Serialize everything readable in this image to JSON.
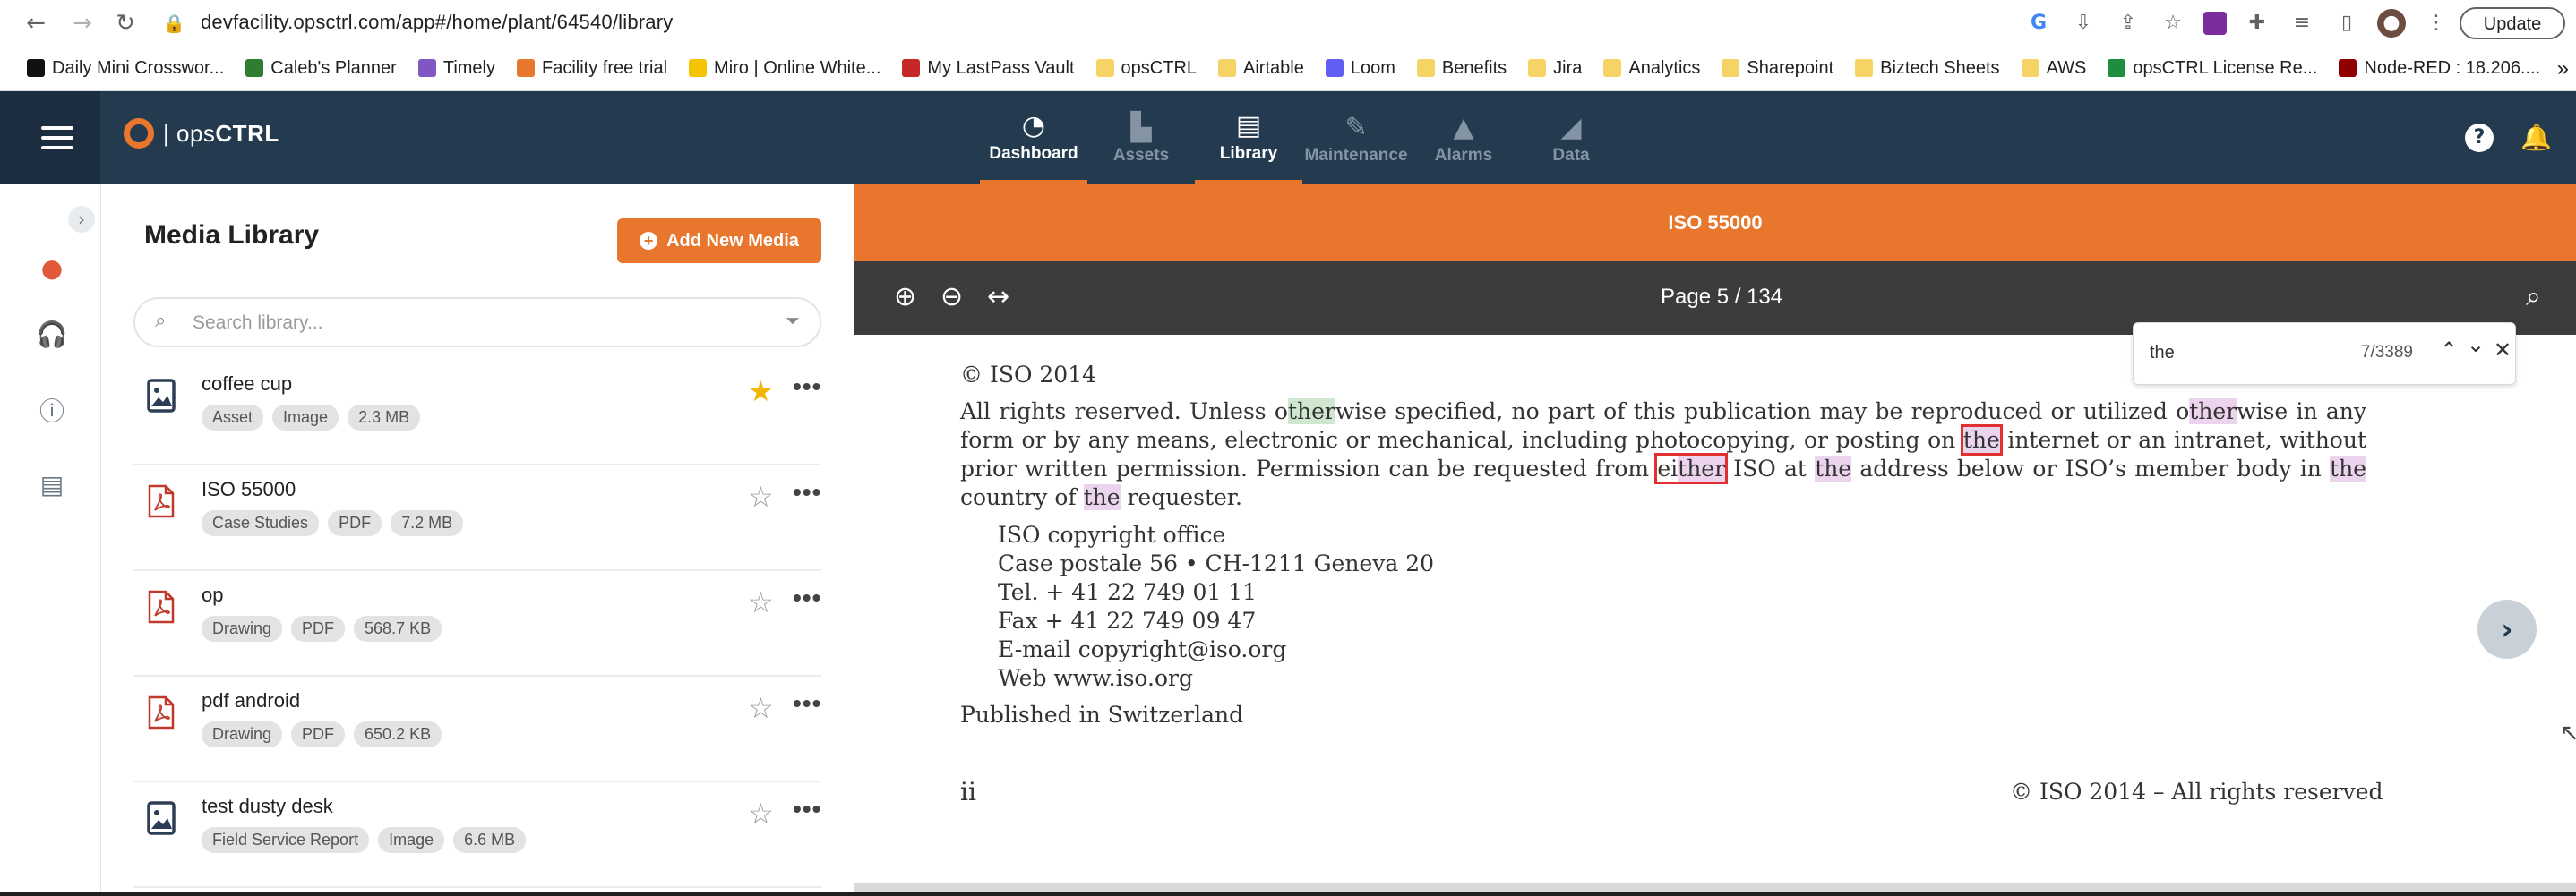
{
  "browser": {
    "url": "devfacility.opsctrl.com/app#/home/plant/64540/library",
    "update_label": "Update",
    "bookmarks": [
      {
        "label": "Daily Mini Crosswor...",
        "color": "#111111"
      },
      {
        "label": "Caleb's Planner",
        "color": "#2e7d32"
      },
      {
        "label": "Timely",
        "color": "#7e57c2"
      },
      {
        "label": "Facility free trial",
        "color": "#e8762c"
      },
      {
        "label": "Miro | Online White...",
        "color": "#f5c400"
      },
      {
        "label": "My LastPass Vault",
        "color": "#c62828"
      },
      {
        "label": "opsCTRL",
        "color": "#f6d365"
      },
      {
        "label": "Airtable",
        "color": "#f6d365"
      },
      {
        "label": "Loom",
        "color": "#625df5"
      },
      {
        "label": "Benefits",
        "color": "#f6d365"
      },
      {
        "label": "Jira",
        "color": "#f6d365"
      },
      {
        "label": "Analytics",
        "color": "#f6d365"
      },
      {
        "label": "Sharepoint",
        "color": "#f6d365"
      },
      {
        "label": "Biztech Sheets",
        "color": "#f6d365"
      },
      {
        "label": "AWS",
        "color": "#f6d365"
      },
      {
        "label": "opsCTRL License Re...",
        "color": "#1e8e3e"
      },
      {
        "label": "Node-RED : 18.206....",
        "color": "#8f0000"
      }
    ]
  },
  "app": {
    "logo_prefix": "| ops",
    "logo_suffix": "CTRL",
    "nav": [
      {
        "label": "Dashboard",
        "icon": "gauge-icon",
        "glyph": "◔",
        "active": true
      },
      {
        "label": "Assets",
        "icon": "factory-icon",
        "glyph": "▙",
        "active": false
      },
      {
        "label": "Library",
        "icon": "book-icon",
        "glyph": "▤",
        "active": true
      },
      {
        "label": "Maintenance",
        "icon": "wrench-icon",
        "glyph": "✎",
        "active": false
      },
      {
        "label": "Alarms",
        "icon": "warning-icon",
        "glyph": "▲",
        "active": false
      },
      {
        "label": "Data",
        "icon": "area-chart-icon",
        "glyph": "◢",
        "active": false
      }
    ]
  },
  "library": {
    "title": "Media Library",
    "add_label": "Add New Media",
    "search_placeholder": "Search library...",
    "items": [
      {
        "name": "coffee cup",
        "tags": [
          "Asset",
          "Image",
          "2.3 MB"
        ],
        "type": "image",
        "starred": true
      },
      {
        "name": "ISO 55000",
        "tags": [
          "Case Studies",
          "PDF",
          "7.2 MB"
        ],
        "type": "pdf",
        "starred": false
      },
      {
        "name": "op",
        "tags": [
          "Drawing",
          "PDF",
          "568.7 KB"
        ],
        "type": "pdf",
        "starred": false
      },
      {
        "name": "pdf android",
        "tags": [
          "Drawing",
          "PDF",
          "650.2 KB"
        ],
        "type": "pdf",
        "starred": false
      },
      {
        "name": "test dusty desk",
        "tags": [
          "Field Service Report",
          "Image",
          "6.6 MB"
        ],
        "type": "image",
        "starred": false
      }
    ]
  },
  "viewer": {
    "doc_title": "ISO 55000",
    "page_label": "Page  5 / 134",
    "find": {
      "term": "the",
      "count": "7/3389"
    },
    "doc": {
      "copyright": "© ISO 2014",
      "addr": [
        "ISO copyright office",
        "Case postale 56 • CH-1211 Geneva 20",
        "Tel. + 41 22 749 01 11",
        "Fax + 41 22 749 09 47",
        "E-mail copyright@iso.org",
        "Web www.iso.org"
      ],
      "published": "Published in Switzerland",
      "page_number": "ii",
      "footer": "© ISO 2014 – All rights reserved"
    }
  },
  "colors": {
    "brand_orange": "#e8762c",
    "header_navy": "#233a4f",
    "highlight": "#ecd3ee",
    "current_highlight": "#cfe6cf"
  }
}
